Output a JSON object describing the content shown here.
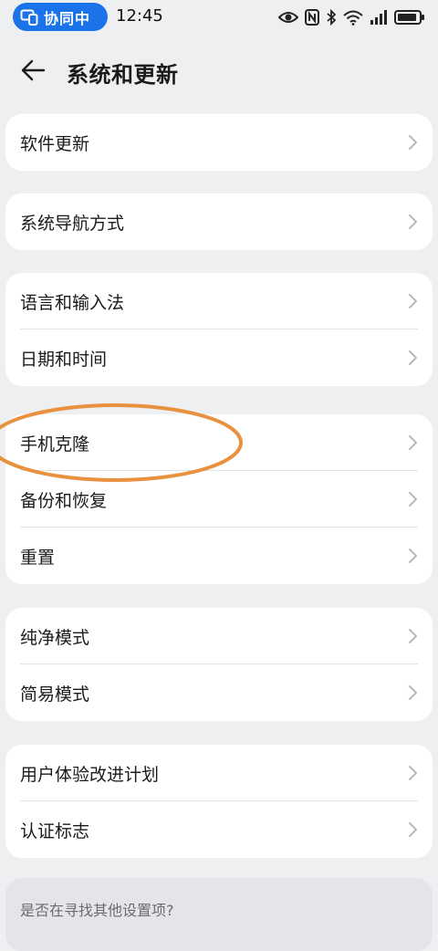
{
  "status_bar": {
    "collab_label": "协同中",
    "time": "12:45"
  },
  "header": {
    "title": "系统和更新"
  },
  "groups": [
    {
      "items": [
        {
          "label": "软件更新"
        }
      ]
    },
    {
      "items": [
        {
          "label": "系统导航方式"
        }
      ]
    },
    {
      "items": [
        {
          "label": "语言和输入法"
        },
        {
          "label": "日期和时间"
        }
      ]
    },
    {
      "items": [
        {
          "label": "手机克隆"
        },
        {
          "label": "备份和恢复"
        },
        {
          "label": "重置"
        }
      ]
    },
    {
      "items": [
        {
          "label": "纯净模式"
        },
        {
          "label": "简易模式"
        }
      ]
    },
    {
      "items": [
        {
          "label": "用户体验改进计划"
        },
        {
          "label": "认证标志"
        }
      ]
    }
  ],
  "search_hint": {
    "text": "是否在寻找其他设置项?"
  },
  "colors": {
    "accent": "#1a73e8",
    "annotation": "#e8913f",
    "background": "#eeeff1"
  },
  "icons": {
    "collab": "multi-device-icon",
    "eye": "eye-icon",
    "nfc": "nfc-icon",
    "bluetooth": "bluetooth-icon",
    "wifi": "wifi-icon",
    "signal": "signal-icon",
    "battery": "battery-icon",
    "back": "back-arrow-icon",
    "chevron": "chevron-right-icon"
  }
}
